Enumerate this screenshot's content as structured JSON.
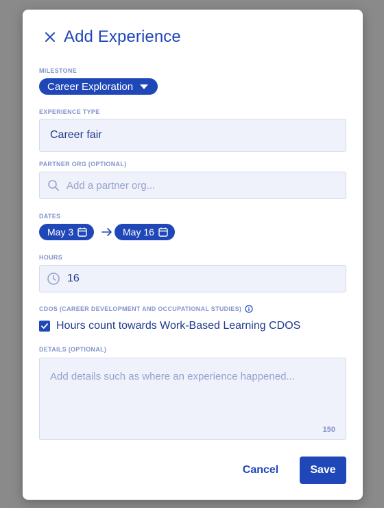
{
  "dialog": {
    "title": "Add Experience"
  },
  "milestone": {
    "label": "MILESTONE",
    "value": "Career Exploration"
  },
  "experience_type": {
    "label": "EXPERIENCE TYPE",
    "value": "Career fair"
  },
  "partner_org": {
    "label": "PARTNER ORG (OPTIONAL)",
    "placeholder": "Add a partner org..."
  },
  "dates": {
    "label": "DATES",
    "start": "May 3",
    "end": "May 16"
  },
  "hours": {
    "label": "HOURS",
    "value": "16"
  },
  "cdos": {
    "label": "CDOS (CAREER DEVELOPMENT AND OCCUPATIONAL STUDIES)",
    "checkbox_label": "Hours count towards Work-Based Learning CDOS",
    "checked": true
  },
  "details": {
    "label": "DETAILS (OPTIONAL)",
    "placeholder": "Add details such as where an experience happened...",
    "char_count": "150"
  },
  "actions": {
    "cancel": "Cancel",
    "save": "Save"
  },
  "colors": {
    "accent": "#1f47b8",
    "label": "#8393cc",
    "field_bg": "#eff2fb",
    "overlay": "#8a8a8a"
  }
}
